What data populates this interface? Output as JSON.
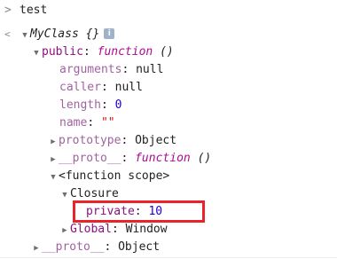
{
  "input": {
    "prompt_symbol": ">",
    "command": "test"
  },
  "output": {
    "result_symbol": "<",
    "class_name": "MyClass {}",
    "info_badge": "i",
    "public_key": "public",
    "function_keyword": "function",
    "function_parens": "()",
    "properties": {
      "arguments": {
        "key": "arguments",
        "value": "null"
      },
      "caller": {
        "key": "caller",
        "value": "null"
      },
      "length": {
        "key": "length",
        "value": "0"
      },
      "name": {
        "key": "name",
        "value": "\"\""
      },
      "prototype": {
        "key": "prototype",
        "value": "Object"
      },
      "proto": {
        "key": "__proto__",
        "keyword": "function",
        "parens": "()"
      }
    },
    "function_scope_label": "<function scope>",
    "closure_label": "Closure",
    "private_var": {
      "key": "private",
      "value": "10"
    },
    "global": {
      "key": "Global",
      "value": "Window"
    },
    "outer_proto": {
      "key": "__proto__",
      "value": "Object"
    }
  },
  "colors": {
    "highlight_box": "#e8232a",
    "property_key": "#881280",
    "number": "#1c00cf",
    "string": "#c41a16",
    "keyword": "#aa0d91"
  },
  "icons": {
    "prompt": "chevron-right-icon",
    "result": "left-arrow-icon",
    "expanded": "triangle-down-icon",
    "collapsed": "triangle-right-icon"
  }
}
